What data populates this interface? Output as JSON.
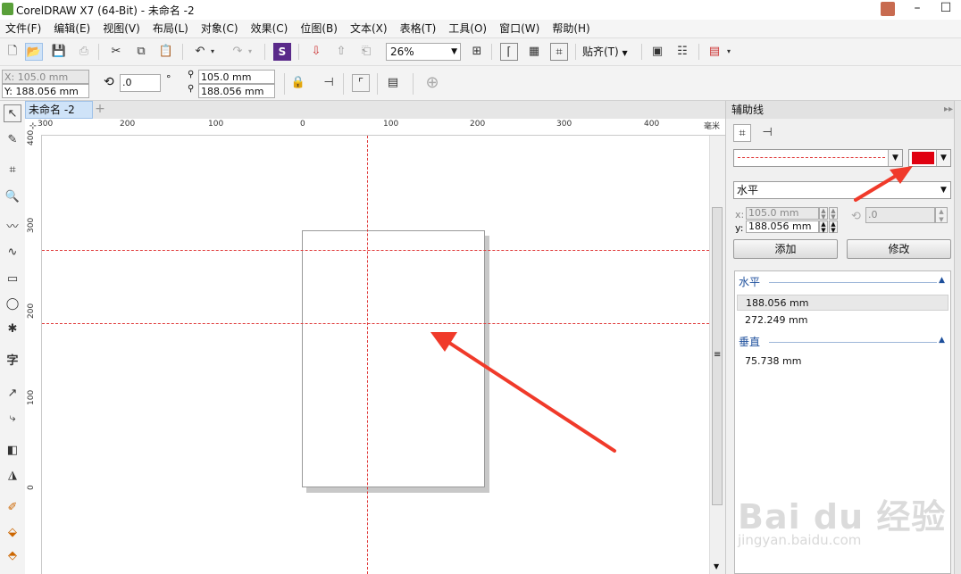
{
  "window": {
    "title": "CorelDRAW X7 (64-Bit) - 未命名 -2",
    "minimize": "–",
    "maximize": "☐",
    "close": "✕"
  },
  "menu": [
    "文件(F)",
    "编辑(E)",
    "视图(V)",
    "布局(L)",
    "对象(C)",
    "效果(C)",
    "位图(B)",
    "文本(X)",
    "表格(T)",
    "工具(O)",
    "窗口(W)",
    "帮助(H)"
  ],
  "toolbar": {
    "zoom": "26%",
    "snap_label": "贴齐(T)"
  },
  "properties": {
    "x_pos": "X: 105.0 mm",
    "y_pos": "Y: 188.056 mm",
    "rotation": ".0",
    "degree_symbol": "°",
    "size_w": "105.0 mm",
    "size_h": "188.056 mm"
  },
  "document": {
    "tab_name": "未命名 -2",
    "unit": "毫米",
    "h_ruler": [
      "300",
      "200",
      "100",
      "0",
      "100",
      "200",
      "300",
      "400"
    ],
    "v_ruler": [
      "400",
      "300",
      "200",
      "100",
      "0"
    ]
  },
  "docker": {
    "title": "辅助线",
    "line_color": "#e00010",
    "orientation": "水平",
    "x_label": "x:",
    "x_value": "105.0 mm",
    "y_label": "y:",
    "y_value": "188.056 mm",
    "angle_value": ".0",
    "add_button": "添加",
    "modify_button": "修改",
    "groups": {
      "horizontal_title": "水平",
      "horizontal_items": [
        "188.056 mm",
        "272.249 mm"
      ],
      "vertical_title": "垂直",
      "vertical_items": [
        "75.738 mm"
      ]
    }
  },
  "watermark": {
    "main": "Bai du 经验",
    "sub": "jingyan.baidu.com"
  },
  "colors": {
    "guide": "#e03a3a",
    "annotation_arrow": "#f03a2a",
    "accent": "#cfe3f8"
  }
}
